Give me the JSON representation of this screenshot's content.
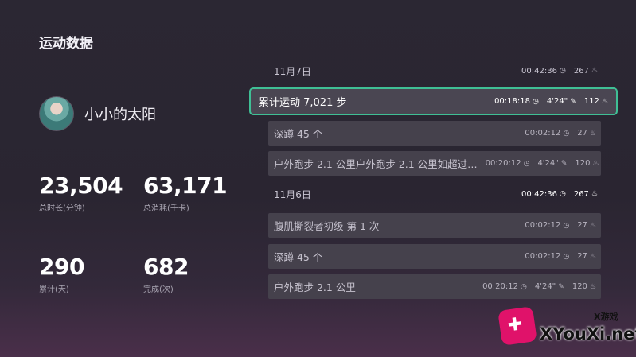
{
  "page": {
    "title": "运动数据"
  },
  "profile": {
    "name": "小小的太阳"
  },
  "stats": [
    {
      "value": "23,504",
      "label": "总时长(分钟)"
    },
    {
      "value": "63,171",
      "label": "总消耗(千卡)"
    },
    {
      "value": "290",
      "label": "累计(天)"
    },
    {
      "value": "682",
      "label": "完成(次)"
    }
  ],
  "days": [
    {
      "date": "11月7日",
      "duration": "00:42:36",
      "calories": "267",
      "items": [
        {
          "title": "累计运动 7,021 步",
          "duration": "00:18:18",
          "pace": "4'24\"",
          "calories": "112"
        },
        {
          "title": "深蹲 45 个",
          "duration": "00:02:12",
          "calories": "27"
        },
        {
          "title": "户外跑步 2.1 公里户外跑步 2.1 公里如超过…",
          "duration": "00:20:12",
          "pace": "4'24\"",
          "calories": "120"
        }
      ]
    },
    {
      "date": "11月6日",
      "duration": "00:42:36",
      "calories": "267",
      "items": [
        {
          "title": "腹肌撕裂者初级 第 1 次",
          "duration": "00:02:12",
          "calories": "27"
        },
        {
          "title": "深蹲 45 个",
          "duration": "00:02:12",
          "calories": "27"
        },
        {
          "title": "户外跑步 2.1 公里",
          "duration": "00:20:12",
          "pace": "4'24\"",
          "calories": "120"
        }
      ]
    }
  ],
  "icons": {
    "clock": "clock-icon",
    "flame": "flame-icon",
    "shoe": "shoe-icon"
  },
  "colors": {
    "selected_border": "#3fbf95",
    "row_bg": "#45414c"
  },
  "watermark": {
    "top": "X游戏",
    "text": "XYouXi.net"
  }
}
